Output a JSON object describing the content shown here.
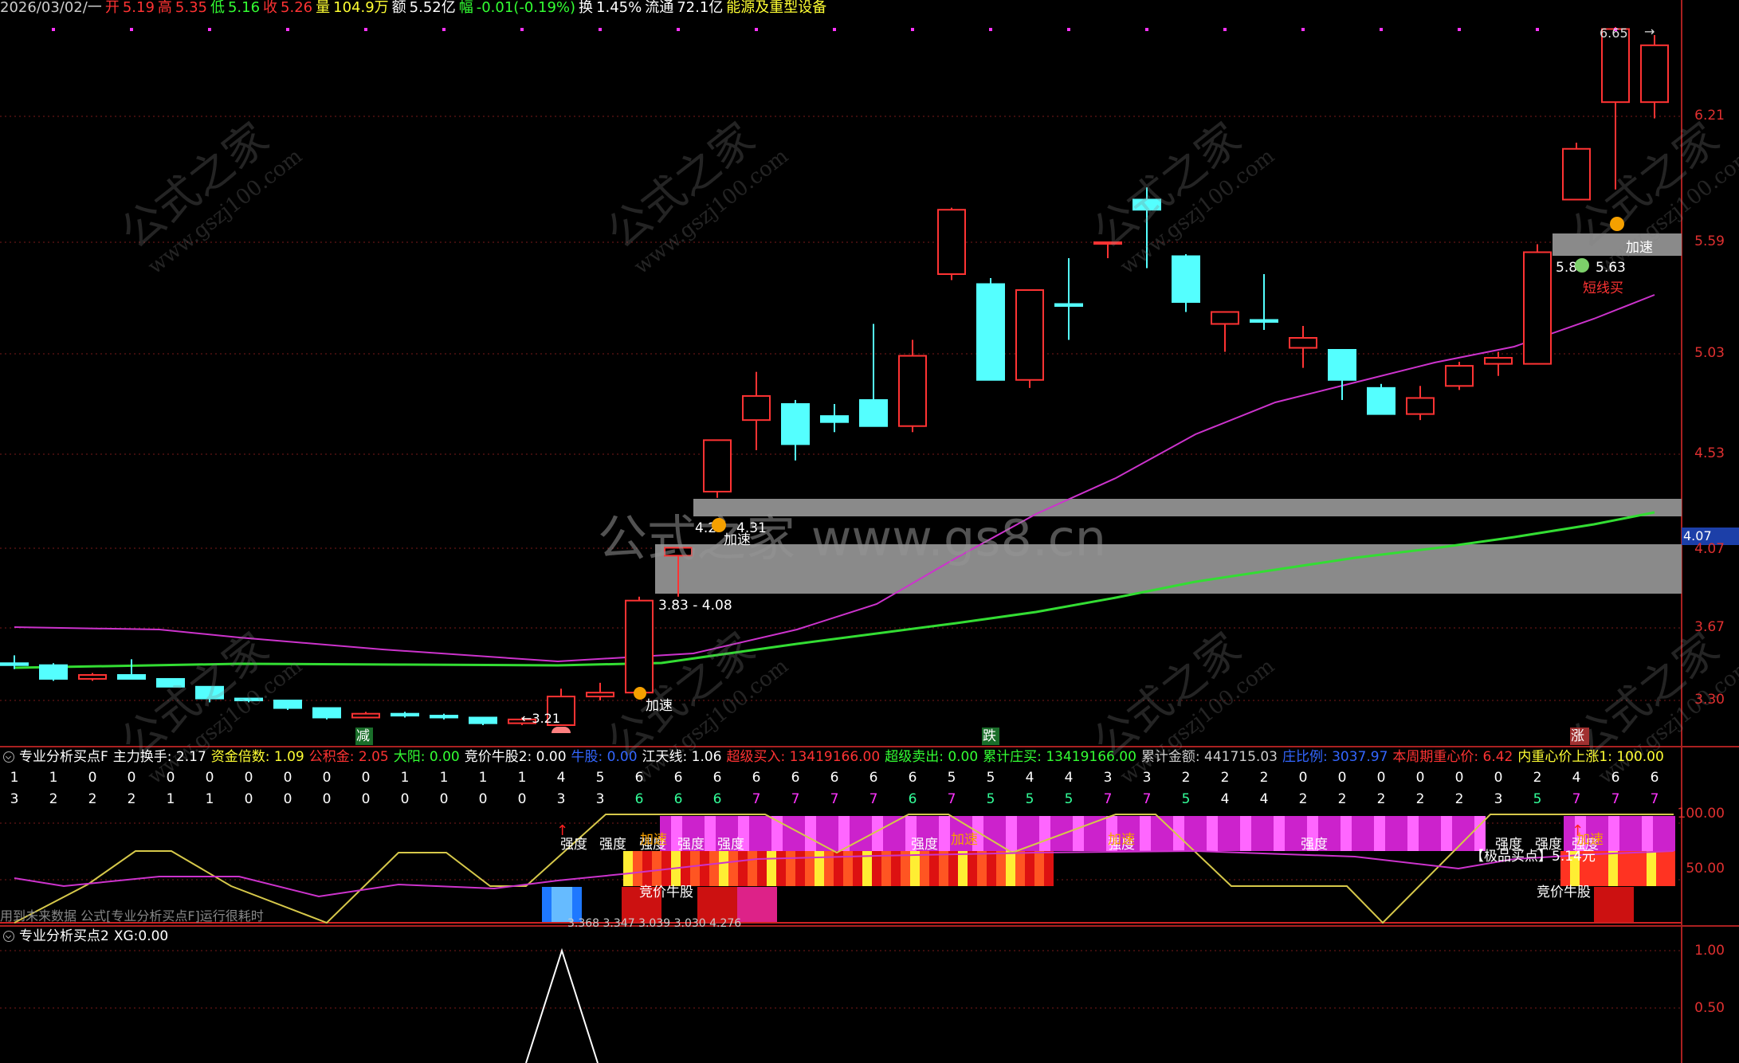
{
  "quote": {
    "date": "2026/03/02/一",
    "open_label": "开",
    "open": "5.19",
    "high_label": "高",
    "high": "5.35",
    "low_label": "低",
    "low": "5.16",
    "close_label": "收",
    "close": "5.26",
    "volume_label": "量",
    "volume": "104.9万",
    "amount_label": "额",
    "amount": "5.52亿",
    "amp_label": "幅",
    "amp": "-0.01(-0.19%)",
    "turnover_label": "换",
    "turnover": "1.45%",
    "float_label": "流通",
    "float": "72.1亿",
    "sector": "能源及重型设备"
  },
  "main_chart": {
    "price_axis": [
      "6.21",
      "5.59",
      "5.03",
      "4.53",
      "3.67",
      "3.30"
    ],
    "current_price_tag": "4.07",
    "hidden_axis_label": "4.07",
    "labels": {
      "peak": "6.65",
      "zone1": "3.83 - 4.08",
      "zone2_low": "4.2",
      "zone2_high": "4.31",
      "accel_1": "加速",
      "accel_2": "加速",
      "accel_3": "加速",
      "zone3_low": "5.8",
      "zone3_high": "5.63",
      "short_buy": "短线买",
      "low_point": "3.21",
      "sig_jian": "减",
      "sig_die": "跌",
      "sig_zhang": "涨"
    },
    "colors": {
      "up": "#ff3333",
      "down": "#54ffff",
      "ma_short": "#cc33cc",
      "ma_long": "#33dd33",
      "zone": "#888888"
    },
    "candles": [
      {
        "o": 3.49,
        "h": 3.53,
        "l": 3.46,
        "c": 3.48
      },
      {
        "o": 3.48,
        "h": 3.49,
        "l": 3.4,
        "c": 3.41
      },
      {
        "o": 3.41,
        "h": 3.44,
        "l": 3.4,
        "c": 3.43
      },
      {
        "o": 3.43,
        "h": 3.51,
        "l": 3.41,
        "c": 3.41
      },
      {
        "o": 3.41,
        "h": 3.41,
        "l": 3.37,
        "c": 3.37
      },
      {
        "o": 3.37,
        "h": 3.37,
        "l": 3.29,
        "c": 3.31
      },
      {
        "o": 3.31,
        "h": 3.31,
        "l": 3.29,
        "c": 3.3
      },
      {
        "o": 3.3,
        "h": 3.3,
        "l": 3.25,
        "c": 3.26
      },
      {
        "o": 3.26,
        "h": 3.26,
        "l": 3.2,
        "c": 3.21
      },
      {
        "o": 3.21,
        "h": 3.24,
        "l": 3.21,
        "c": 3.23
      },
      {
        "o": 3.23,
        "h": 3.24,
        "l": 3.21,
        "c": 3.22
      },
      {
        "o": 3.22,
        "h": 3.23,
        "l": 3.2,
        "c": 3.21
      },
      {
        "o": 3.21,
        "h": 3.21,
        "l": 3.17,
        "c": 3.18
      },
      {
        "o": 3.18,
        "h": 3.21,
        "l": 3.17,
        "c": 3.2
      },
      {
        "o": 3.17,
        "h": 3.36,
        "l": 3.17,
        "c": 3.32
      },
      {
        "o": 3.32,
        "h": 3.39,
        "l": 3.3,
        "c": 3.34
      },
      {
        "o": 3.34,
        "h": 3.83,
        "l": 3.33,
        "c": 3.81
      },
      {
        "o": 4.04,
        "h": 4.08,
        "l": 3.83,
        "c": 4.08
      },
      {
        "o": 4.35,
        "h": 4.6,
        "l": 4.32,
        "c": 4.6
      },
      {
        "o": 4.7,
        "h": 4.94,
        "l": 4.55,
        "c": 4.82
      },
      {
        "o": 4.78,
        "h": 4.8,
        "l": 4.5,
        "c": 4.58
      },
      {
        "o": 4.72,
        "h": 4.78,
        "l": 4.64,
        "c": 4.69
      },
      {
        "o": 4.8,
        "h": 5.18,
        "l": 4.68,
        "c": 4.67
      },
      {
        "o": 4.67,
        "h": 5.1,
        "l": 4.64,
        "c": 5.02
      },
      {
        "o": 5.43,
        "h": 5.76,
        "l": 5.4,
        "c": 5.75
      },
      {
        "o": 5.38,
        "h": 5.41,
        "l": 4.9,
        "c": 4.9
      },
      {
        "o": 4.9,
        "h": 5.35,
        "l": 4.86,
        "c": 5.35
      },
      {
        "o": 5.28,
        "h": 5.51,
        "l": 5.1,
        "c": 5.27
      },
      {
        "o": 5.59,
        "h": 5.59,
        "l": 5.51,
        "c": 5.59
      },
      {
        "o": 5.8,
        "h": 5.86,
        "l": 5.46,
        "c": 5.75
      },
      {
        "o": 5.52,
        "h": 5.53,
        "l": 5.24,
        "c": 5.29
      },
      {
        "o": 5.18,
        "h": 5.24,
        "l": 5.04,
        "c": 5.24
      },
      {
        "o": 5.2,
        "h": 5.43,
        "l": 5.15,
        "c": 5.19
      },
      {
        "o": 5.06,
        "h": 5.17,
        "l": 4.96,
        "c": 5.11
      },
      {
        "o": 5.05,
        "h": 5.05,
        "l": 4.8,
        "c": 4.9
      },
      {
        "o": 4.86,
        "h": 4.88,
        "l": 4.73,
        "c": 4.73
      },
      {
        "o": 4.73,
        "h": 4.87,
        "l": 4.7,
        "c": 4.81
      },
      {
        "o": 4.87,
        "h": 4.99,
        "l": 4.85,
        "c": 4.97
      },
      {
        "o": 4.98,
        "h": 5.04,
        "l": 4.92,
        "c": 5.01
      },
      {
        "o": 4.98,
        "h": 5.58,
        "l": 4.98,
        "c": 5.54
      },
      {
        "o": 5.8,
        "h": 6.08,
        "l": 5.8,
        "c": 6.05
      },
      {
        "o": 6.28,
        "h": 6.65,
        "l": 5.85,
        "c": 6.64
      },
      {
        "o": 6.28,
        "h": 6.61,
        "l": 6.2,
        "c": 6.56
      }
    ]
  },
  "pane1": {
    "title": "专业分析买点F",
    "fields": [
      {
        "label": "主力换手",
        "value": "2.17",
        "color": "#ffffff"
      },
      {
        "label": "资金倍数",
        "value": "1.09",
        "color": "#ffff33"
      },
      {
        "label": "公积金",
        "value": "2.05",
        "color": "#ff3333"
      },
      {
        "label": "大阳",
        "value": "0.00",
        "color": "#33ff33"
      },
      {
        "label": "竞价牛股2",
        "value": "0.00",
        "color": "#ffffff"
      },
      {
        "label": "牛股",
        "value": "0.00",
        "color": "#3366ff"
      },
      {
        "label": "江天线",
        "value": "1.06",
        "color": "#ffffff"
      },
      {
        "label": "超级买入",
        "value": "13419166.00",
        "color": "#ff3333"
      },
      {
        "label": "超级卖出",
        "value": "0.00",
        "color": "#33ff33"
      },
      {
        "label": "累计庄买",
        "value": "13419166.00",
        "color": "#33ff33"
      },
      {
        "label": "累计金额",
        "value": "441715.03",
        "color": "#cccccc"
      },
      {
        "label": "庄比例",
        "value": "3037.97",
        "color": "#3366ff"
      },
      {
        "label": "本周期重心价",
        "value": "6.42",
        "color": "#ff3333"
      },
      {
        "label": "内重心价上涨1",
        "value": "100.00",
        "color": "#ffff33"
      }
    ],
    "row1": [
      "1",
      "1",
      "0",
      "0",
      "0",
      "0",
      "0",
      "0",
      "0",
      "0",
      "1",
      "1",
      "1",
      "1",
      "4",
      "5",
      "6",
      "6",
      "6",
      "6",
      "6",
      "6",
      "6",
      "6",
      "5",
      "5",
      "4",
      "4",
      "3",
      "3",
      "2",
      "2",
      "2",
      "0",
      "0",
      "0",
      "0",
      "0",
      "0",
      "2",
      "4",
      "6",
      "6"
    ],
    "row2": [
      "3",
      "2",
      "2",
      "2",
      "1",
      "1",
      "0",
      "0",
      "0",
      "0",
      "0",
      "0",
      "0",
      "0",
      "3",
      "3",
      "6",
      "6",
      "6",
      "7",
      "7",
      "7",
      "7",
      "6",
      "7",
      "5",
      "5",
      "5",
      "7",
      "7",
      "5",
      "4",
      "4",
      "2",
      "2",
      "2",
      "2",
      "2",
      "3",
      "5",
      "7",
      "7",
      "7"
    ],
    "axis": [
      "100.00",
      "50.00"
    ],
    "text_qiangdu": "强度",
    "text_jiasu": "加速",
    "text_jingjia": "竞价牛股",
    "text_jipin": "【极品买点】5.14元",
    "bottom_note": "用到未来数据 公式[专业分析买点F]运行很耗时",
    "bottom_values": "3.368 3.347 3.039 3.030   4.276"
  },
  "pane2": {
    "title": "专业分析买点2",
    "field_label": "XG",
    "field_value": "0.00",
    "axis": [
      "1.00",
      "0.50"
    ]
  },
  "watermark": {
    "text_big": "公式之家",
    "text_small": "www.gszj100.com",
    "center": "公式之家 www.gs8.cn"
  }
}
